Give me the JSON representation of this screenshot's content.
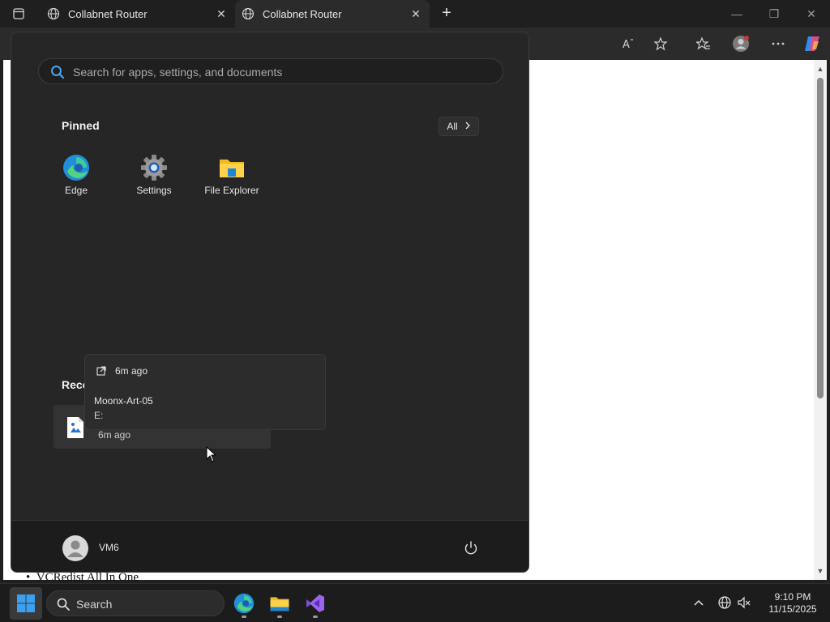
{
  "browser": {
    "tabs": [
      {
        "label": "Collabnet Router",
        "active": false
      },
      {
        "label": "Collabnet Router",
        "active": true
      }
    ],
    "toolbar_icons": [
      "read-aloud-icon",
      "favorite-star-icon",
      "favorites-icon",
      "profile-icon",
      "more-icon",
      "copilot-icon"
    ],
    "page_text": "VCRedist All In One"
  },
  "start_menu": {
    "search_placeholder": "Search for apps, settings, and documents",
    "pinned_title": "Pinned",
    "all_label": "All",
    "pinned_apps": [
      {
        "label": "Edge",
        "icon": "edge-icon"
      },
      {
        "label": "Settings",
        "icon": "settings-gear-icon"
      },
      {
        "label": "File Explorer",
        "icon": "folder-icon"
      }
    ],
    "recommended_title_visible": "Reco",
    "recent_item": {
      "time": "6m ago",
      "icon": "image-file-icon"
    },
    "tooltip": {
      "time": "6m ago",
      "name": "Moonx-Art-05",
      "path": "E:"
    },
    "user_name": "VM6"
  },
  "taskbar": {
    "search_label": "Search",
    "apps": [
      "edge-icon",
      "file-explorer-icon",
      "visual-studio-icon"
    ],
    "time": "9:10 PM",
    "date": "11/15/2025"
  },
  "colors": {
    "accent": "#0078d4",
    "start_bg": "#262626",
    "taskbar_bg": "#1c1c1c"
  }
}
